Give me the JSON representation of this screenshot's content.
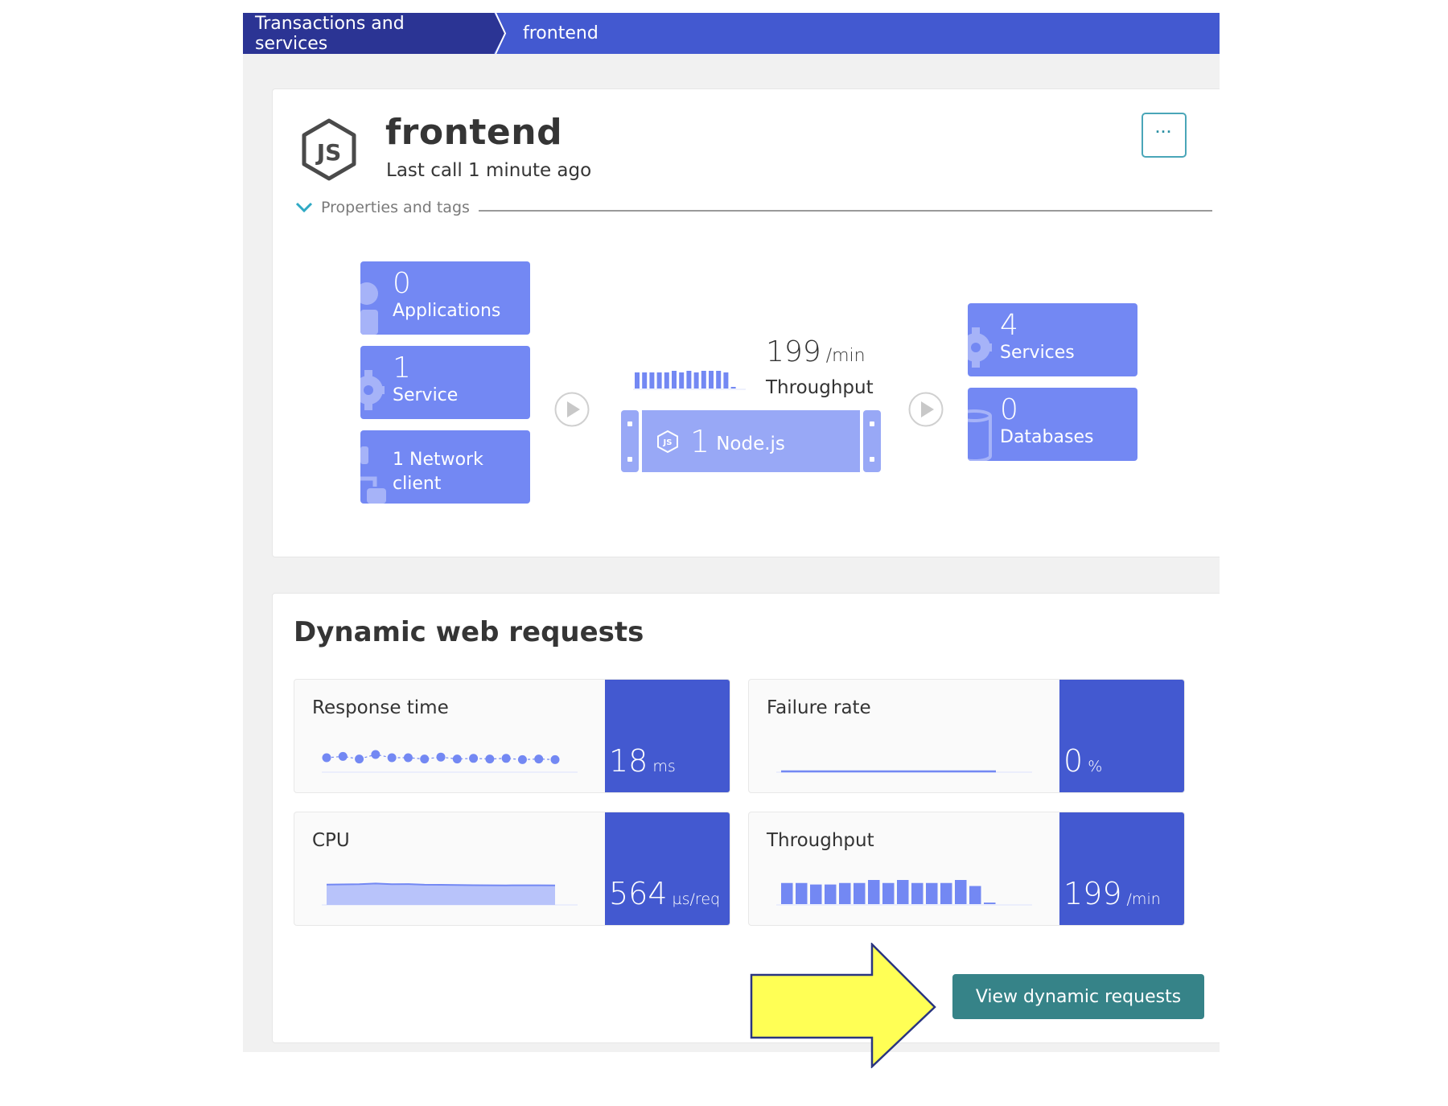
{
  "breadcrumb": {
    "items": [
      {
        "label": "Transactions and services"
      },
      {
        "label": "frontend"
      }
    ]
  },
  "entity": {
    "icon": "nodejs-icon",
    "name": "frontend",
    "subtitle": "Last call 1 minute ago",
    "more_label": "···",
    "properties_label": "Properties and tags"
  },
  "topology": {
    "callers": [
      {
        "count": "0",
        "label": "Applications",
        "icon": "application-icon"
      },
      {
        "count": "1",
        "label": "Service",
        "icon": "service-gear-icon"
      },
      {
        "label": "1 Network client",
        "label_line1": "1 Network",
        "label_line2": "client",
        "icon": "network-client-icon"
      }
    ],
    "throughput": {
      "value": "199",
      "unit": "/min",
      "label": "Throughput",
      "bars": [
        10,
        10,
        10,
        10,
        10,
        11,
        10,
        11,
        10,
        11,
        11,
        11,
        10,
        1
      ]
    },
    "process": {
      "count": "1",
      "label": "Node.js",
      "icon": "nodejs-icon"
    },
    "callees": [
      {
        "count": "4",
        "label": "Services",
        "icon": "service-gear-icon"
      },
      {
        "count": "0",
        "label": "Databases",
        "icon": "database-icon"
      }
    ]
  },
  "dynamic_requests": {
    "title": "Dynamic web requests",
    "metrics": [
      {
        "title": "Response time",
        "value": "18",
        "unit": "ms",
        "chart": "dots",
        "series": [
          18,
          18.2,
          17.8,
          18.5,
          18,
          18,
          17.8,
          18.1,
          17.8,
          17.9,
          17.8,
          17.9,
          17.7,
          17.8,
          17.7
        ]
      },
      {
        "title": "Failure rate",
        "value": "0",
        "unit": "%",
        "chart": "flat",
        "series": [
          0,
          0
        ]
      },
      {
        "title": "CPU",
        "value": "564",
        "unit": "µs/req",
        "chart": "area",
        "series": [
          590,
          595,
          600,
          620,
          600,
          605,
          585,
          583,
          577,
          572,
          570,
          568,
          570,
          570,
          568
        ]
      },
      {
        "title": "Throughput",
        "value": "199",
        "unit": "/min",
        "chart": "bars",
        "series": [
          14,
          14,
          13,
          13,
          14,
          14,
          16,
          14,
          16,
          14,
          14,
          14,
          16,
          12,
          1
        ]
      }
    ],
    "button_label": "View dynamic requests"
  },
  "colors": {
    "accent_dark": "#2b3494",
    "accent": "#4359d0",
    "tile": "#7388f3",
    "process": "#98a8f6",
    "chart": "#7388f3",
    "button": "#368388",
    "annotation_arrow": "#ffff55"
  }
}
